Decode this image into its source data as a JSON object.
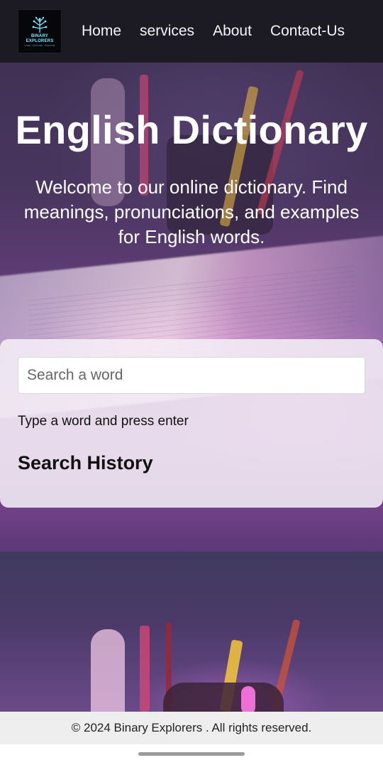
{
  "logo": {
    "name": "BINARY EXPLORERS",
    "tagline": "CODE · EXPLORE · INNOVATE",
    "icon": "circuit-tree-icon",
    "accent": "#7fe9ff"
  },
  "nav": {
    "items": [
      {
        "label": "Home"
      },
      {
        "label": "services"
      },
      {
        "label": "About"
      },
      {
        "label": "Contact-Us"
      }
    ]
  },
  "hero": {
    "title": "English Dictionary",
    "subtitle": "Welcome to our online dictionary. Find meanings, pronunciations, and examples for English words."
  },
  "search": {
    "placeholder": "Search a word",
    "value": "",
    "hint": "Type a word and press enter"
  },
  "history": {
    "title": "Search History"
  },
  "footer": {
    "text": "© 2024 Binary Explorers . All rights reserved."
  },
  "colors": {
    "navbar": "#1c1a22",
    "card": "#f4eef6",
    "footer": "#eeeeee",
    "hero_text": "#ffffff"
  }
}
